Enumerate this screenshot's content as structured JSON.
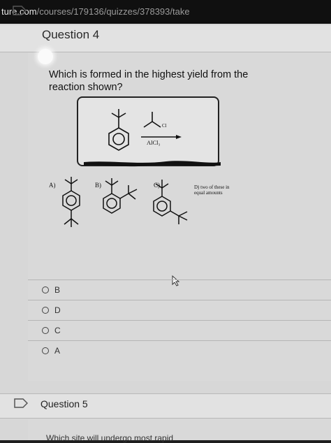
{
  "browser": {
    "url_host": "ture.com",
    "url_path": "/courses/179136/quizzes/378393/take"
  },
  "question4": {
    "title": "Question 4",
    "prompt": "Which is formed in the highest yield from the reaction shown?",
    "reagent_label": "Cl",
    "catalyst": "AlCl₃",
    "option_labels": [
      "A)",
      "B)",
      "C)"
    ],
    "option_d": [
      "D) two of these in",
      "equal amounts"
    ],
    "choices": [
      "B",
      "D",
      "C",
      "A"
    ]
  },
  "question5": {
    "title": "Question 5",
    "prompt": "Which site will undergo most rapid"
  },
  "colors": {
    "page_bg": "#d7d7d7",
    "header_bg": "#e2e2e2",
    "url_bar_bg": "#101010"
  }
}
